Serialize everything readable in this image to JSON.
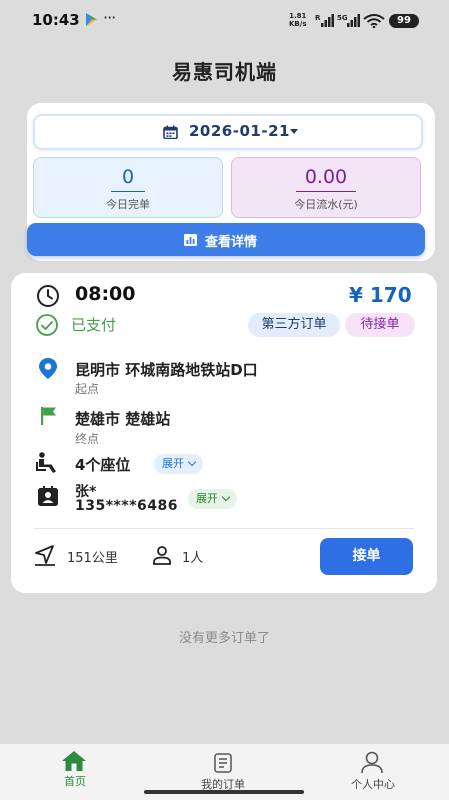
{
  "status_bar": {
    "time": "10:43",
    "more": "···",
    "net_speed_value": "1.81",
    "net_speed_unit": "KB/s",
    "signal_1_label": "R",
    "signal_2_label": "5G",
    "battery": "99"
  },
  "header": {
    "title": "易惠司机端"
  },
  "summary": {
    "date": "2026-01-21",
    "completed_count": "0",
    "completed_label": "今日完单",
    "revenue_value": "0.00",
    "revenue_label": "今日流水(元)",
    "detail_button": "查看详情"
  },
  "order": {
    "time": "08:00",
    "price": "¥ 170",
    "payment_status": "已支付",
    "source_badge": "第三方订单",
    "status_badge": "待接单",
    "start_place": "昆明市 环城南路地铁站D口",
    "start_label": "起点",
    "end_place": "楚雄市 楚雄站",
    "end_label": "终点",
    "seats": "4个座位",
    "expand_label": "展开",
    "passenger_name": "张*",
    "passenger_phone": "135****6486",
    "distance": "151公里",
    "passengers": "1人",
    "accept_button": "接单"
  },
  "list_footer": "没有更多订单了",
  "tabbar": {
    "home": "首页",
    "orders": "我的订单",
    "profile": "个人中心"
  },
  "colors": {
    "primary_blue": "#3d7ee8",
    "price_blue": "#1565c0",
    "paid_green": "#43a047",
    "badge_purple": "#8e24aa"
  }
}
